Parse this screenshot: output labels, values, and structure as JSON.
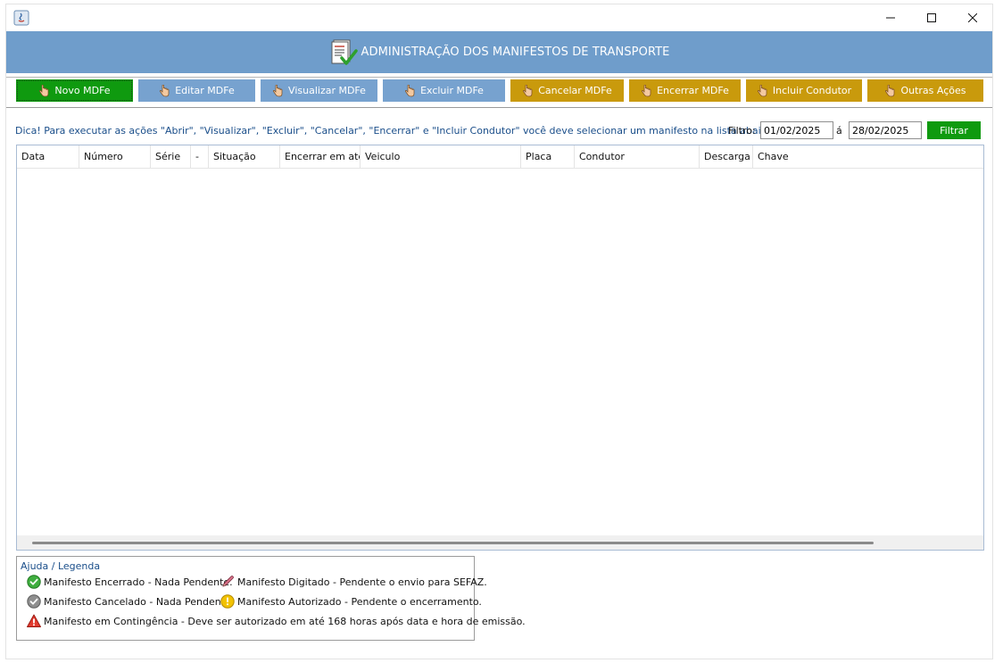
{
  "header": {
    "title": "ADMINISTRAÇÃO DOS MANIFESTOS DE TRANSPORTE"
  },
  "toolbar": {
    "buttons": [
      {
        "label": "Novo MDFe"
      },
      {
        "label": "Editar MDFe"
      },
      {
        "label": "Visualizar MDFe"
      },
      {
        "label": "Excluir MDFe"
      },
      {
        "label": "Cancelar MDFe"
      },
      {
        "label": "Encerrar MDFe"
      },
      {
        "label": "Incluir Condutor"
      },
      {
        "label": "Outras Ações"
      }
    ]
  },
  "tip": "Dica! Para executar as ações \"Abrir\", \"Visualizar\", \"Excluir\", \"Cancelar\", \"Encerrar\" e \"Incluir Condutor\" você deve selecionar um manifesto na lista abaixo.",
  "filter": {
    "label": "Filtro:",
    "from": "01/02/2025",
    "separator": "á",
    "to": "28/02/2025",
    "button": "Filtrar"
  },
  "table": {
    "columns": [
      "Data",
      "Número",
      "Série",
      "-",
      "Situação",
      "Encerrar em até",
      "Veiculo",
      "Placa",
      "Condutor",
      "Descarga",
      "Chave"
    ],
    "rows": []
  },
  "legend": {
    "title": "Ajuda / Legenda",
    "items": [
      {
        "icon": "check-circle-icon",
        "text": "Manifesto Encerrado - Nada Pendente."
      },
      {
        "icon": "pencil-icon",
        "text": "Manifesto Digitado - Pendente o envio para SEFAZ."
      },
      {
        "icon": "gray-check-circle-icon",
        "text": "Manifesto Cancelado - Nada Pendente."
      },
      {
        "icon": "warning-circle-icon",
        "text": "Manifesto Autorizado - Pendente o encerramento."
      },
      {
        "icon": "alert-triangle-icon",
        "text": "Manifesto em Contingência - Deve ser autorizado em até 168 horas após data e hora de emissão."
      }
    ]
  },
  "colors": {
    "header": "#6f9dcb",
    "green": "#0f9a0f",
    "blue": "#77a2cf",
    "gold": "#c99a0c",
    "tip_text": "#1a4e8a"
  }
}
